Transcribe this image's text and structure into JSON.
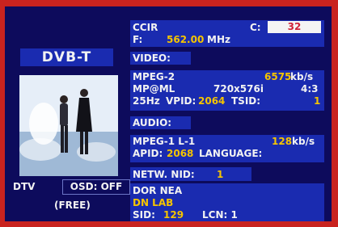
{
  "left": {
    "standard": "DVB-T",
    "mode": "DTV",
    "osd": "OSD: OFF",
    "access": "(FREE)"
  },
  "tuner": {
    "system": "CCIR",
    "channel_label": "C:",
    "channel": "32",
    "freq_label": "F:",
    "freq": "562.00",
    "freq_unit": "MHz"
  },
  "video": {
    "header": "VIDEO:",
    "codec": "MPEG-2",
    "bitrate": "6575",
    "bitrate_unit": "kb/s",
    "profile": "MP@ML",
    "resolution": "720x576i",
    "aspect": "4:3",
    "rate": "25Hz",
    "vpid_label": "VPID:",
    "vpid": "2064",
    "tsid_label": "TSID:",
    "tsid": "1"
  },
  "audio": {
    "header": "AUDIO:",
    "codec": "MPEG-1 L-1",
    "bitrate": "128",
    "bitrate_unit": "kb/s",
    "apid_label": "APID:",
    "apid": "2068",
    "language_label": "LANGUAGE:"
  },
  "network": {
    "label": "NETW.  NID:",
    "nid": "1"
  },
  "service": {
    "network_name": "DOR NEA",
    "provider": "DN LAB",
    "sid_label": "SID:",
    "sid": "129",
    "lcn_label": "LCN: 1"
  },
  "colors": {
    "frame": "#c9231f",
    "background": "#0d0b5c",
    "panel": "#1a2bb0",
    "value": "#f5c400",
    "channel_box": "#f4f4f4"
  }
}
